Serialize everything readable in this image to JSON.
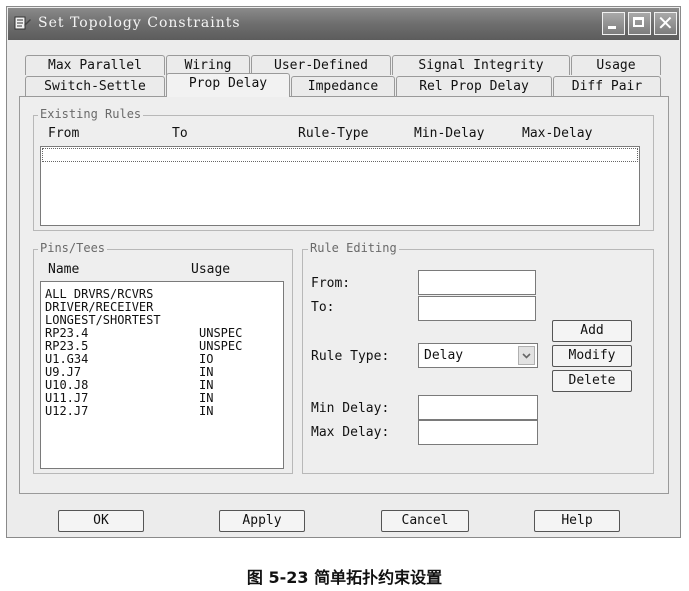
{
  "window": {
    "title": "Set Topology Constraints"
  },
  "tabs": {
    "row_back": [
      "Max Parallel",
      "Wiring",
      "User-Defined",
      "Signal Integrity",
      "Usage"
    ],
    "row_front": [
      "Switch-Settle",
      "Prop Delay",
      "Impedance",
      "Rel Prop Delay",
      "Diff Pair"
    ],
    "active": "Prop Delay"
  },
  "existing_rules": {
    "title": "Existing Rules",
    "columns": [
      "From",
      "To",
      "Rule-Type",
      "Min-Delay",
      "Max-Delay"
    ]
  },
  "pins_tees": {
    "title": "Pins/Tees",
    "columns": [
      "Name",
      "Usage"
    ],
    "items": [
      {
        "name": "ALL DRVRS/RCVRS",
        "usage": ""
      },
      {
        "name": "DRIVER/RECEIVER",
        "usage": ""
      },
      {
        "name": "LONGEST/SHORTEST",
        "usage": ""
      },
      {
        "name": "RP23.4",
        "usage": "UNSPEC"
      },
      {
        "name": "RP23.5",
        "usage": "UNSPEC"
      },
      {
        "name": "U1.G34",
        "usage": "IO"
      },
      {
        "name": "U9.J7",
        "usage": "IN"
      },
      {
        "name": "U10.J8",
        "usage": "IN"
      },
      {
        "name": "U11.J7",
        "usage": "IN"
      },
      {
        "name": "U12.J7",
        "usage": "IN"
      }
    ]
  },
  "rule_editing": {
    "title": "Rule Editing",
    "from_label": "From:",
    "to_label": "To:",
    "rule_type_label": "Rule Type:",
    "rule_type_value": "Delay",
    "min_delay_label": "Min Delay:",
    "max_delay_label": "Max Delay:",
    "add": "Add",
    "modify": "Modify",
    "delete": "Delete"
  },
  "footer": {
    "ok": "OK",
    "apply": "Apply",
    "cancel": "Cancel",
    "help": "Help"
  },
  "caption": "图 5-23    简单拓扑约束设置"
}
